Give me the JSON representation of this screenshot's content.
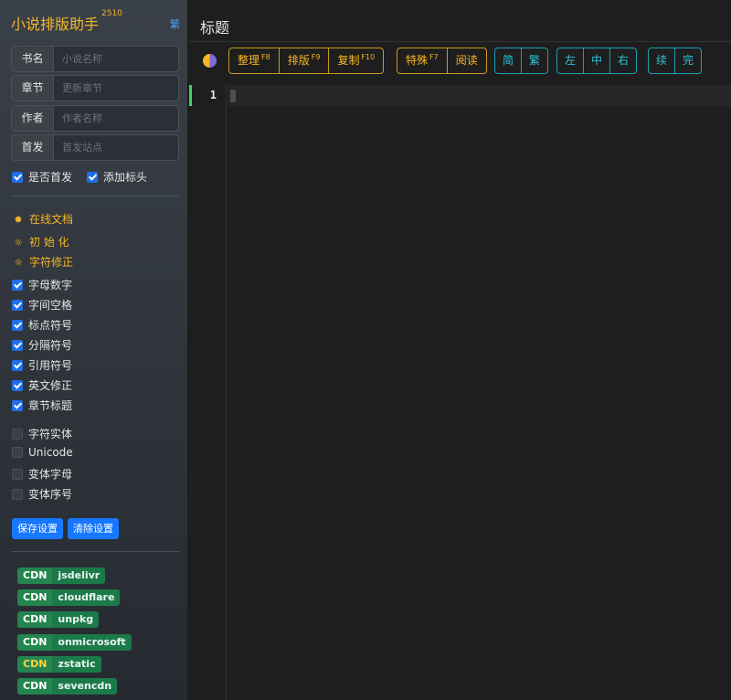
{
  "sidebar": {
    "app_title": "小说排版助手",
    "app_version": "2510",
    "trad_toggle": "繁",
    "fields": [
      {
        "label": "书名",
        "placeholder": "小说名称"
      },
      {
        "label": "章节",
        "placeholder": "更新章节"
      },
      {
        "label": "作者",
        "placeholder": "作者名称"
      },
      {
        "label": "首发",
        "placeholder": "首发站点"
      }
    ],
    "is_first_release": "是否首发",
    "add_header": "添加标头",
    "online_docs": "在线文档",
    "initialize": "初 始 化",
    "char_fix": "字符修正",
    "options_checked": [
      "字母数字",
      "字间空格",
      "标点符号",
      "分隔符号",
      "引用符号",
      "英文修正",
      "章节标题"
    ],
    "options_unchecked": [
      "字符实体",
      "Unicode",
      "变体字母",
      "变体序号"
    ],
    "save_settings": "保存设置",
    "clear_settings": "清除设置",
    "cdn_label": "CDN",
    "cdns": [
      "jsdelivr",
      "cloudflare",
      "unpkg",
      "onmicrosoft",
      "zstatic",
      "sevencdn"
    ]
  },
  "main": {
    "title": "标题",
    "toolbar": {
      "tidy": "整理",
      "tidy_key": "F8",
      "layout": "排版",
      "layout_key": "F9",
      "copy": "复制",
      "copy_key": "F10",
      "special": "特殊",
      "special_key": "F7",
      "read": "阅读",
      "simplified": "简",
      "traditional": "繁",
      "align_left": "左",
      "align_center": "中",
      "align_right": "右",
      "continue": "续",
      "finish": "完"
    },
    "editor": {
      "line_number": "1"
    }
  },
  "colors": {
    "accent_yellow": "#f6b624",
    "accent_cyan": "#2cc4da",
    "primary_blue": "#1677ff",
    "cdn_green": "#1c7a4a"
  }
}
